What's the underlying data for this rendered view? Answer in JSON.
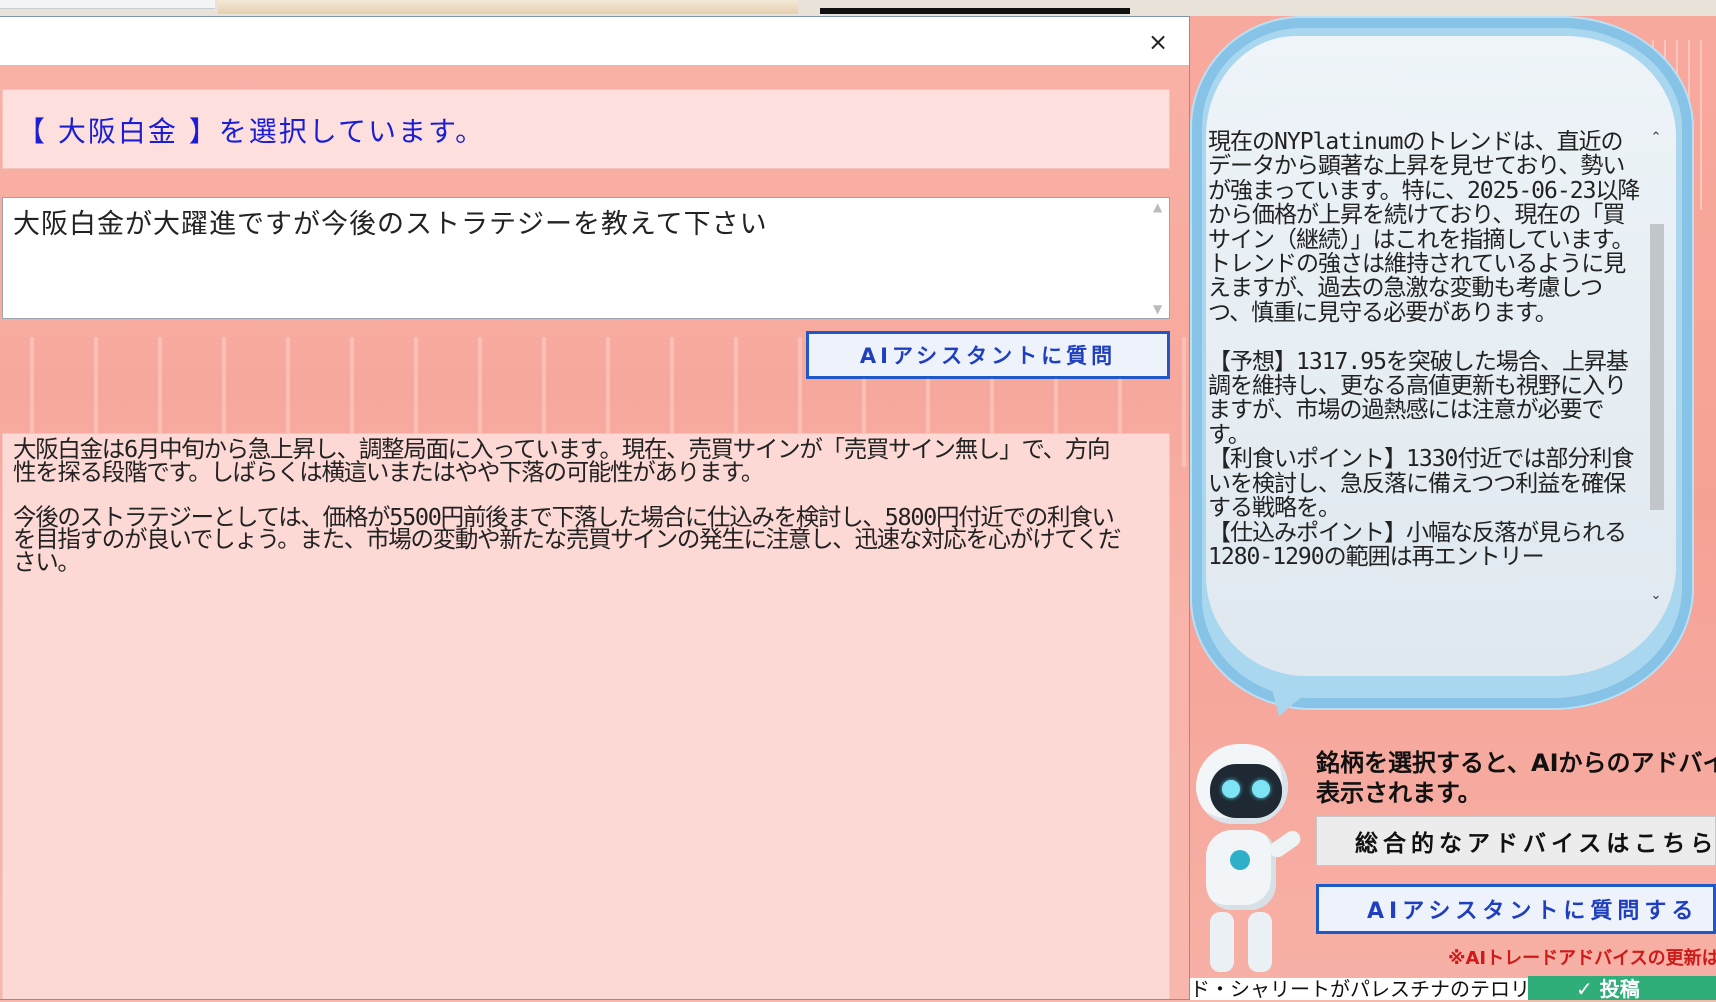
{
  "dialog": {
    "close_label": "×",
    "selected_text": "【 大阪白金 】を選択しています。",
    "question_text": "大阪白金が大躍進ですが今後のストラテジーを教えて下さい",
    "ask_button_label": "AIアシスタントに質問",
    "answer_text": "大阪白金は6月中旬から急上昇し、調整局面に入っています。現在、売買サインが「売買サイン無し」で、方向性を探る段階です。しばらくは横這いまたはやや下落の可能性があります。\n\n今後のストラテジーとしては、価格が5500円前後まで下落した場合に仕込みを検討し、5800円付近での利食いを目指すのが良いでしょう。また、市場の変動や新たな売買サインの発生に注意し、迅速な対応を心がけてください。"
  },
  "advice_panel": {
    "text": "現在のNYPlatinumのトレンドは、直近のデータから顕著な上昇を見せており、勢いが強まっています。特に、2025-06-23以降から価格が上昇を続けており、現在の「買サイン（継続）」はこれを指摘しています。トレンドの強さは維持されているように見えますが、過去の急激な変動も考慮しつつ、慎重に見守る必要があります。\n\n【予想】1317.95を突破した場合、上昇基調を維持し、更なる高値更新も視野に入りますが、市場の過熱感には注意が必要です。\n【利食いポイント】1330付近では部分利食いを検討し、急反落に備えつつ利益を確保する戦略を。\n【仕込みポイント】小幅な反落が見られる1280-1290の範囲は再エントリー",
    "scroll_up": "⌃",
    "scroll_down": "⌄",
    "hint": "銘柄を選択すると、AIからのアドバイスが\n表示されます。",
    "overall_button_label": "総合的なアドバイスはこちら",
    "ask_button_label": "AIアシスタントに質問する",
    "notice": "※AIトレードアドバイスの更新は、"
  },
  "ticker": {
    "text": "ド・シャリートがパレスチナのテロリス",
    "post_button_label": "✓ 投稿"
  },
  "colors": {
    "accent_blue": "#1f58c8",
    "selected_text": "#1b1fd1",
    "notice_red": "#cf1a1a",
    "post_green": "#2fae7a"
  }
}
